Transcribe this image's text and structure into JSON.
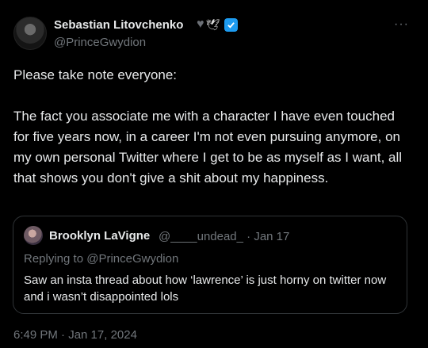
{
  "author": {
    "display_name": "Sebastian Litovchenko",
    "handle": "@PrinceGwydion",
    "badges": [
      "black-heart",
      "wing"
    ]
  },
  "tweet": {
    "paragraph1": "Please take note everyone:",
    "paragraph2": "The fact you associate me with a character I have even touched for five years now, in a career I'm not even pursuing anymore, on my own personal Twitter where I get to be as myself as I want, all that shows you don't give a shit about my happiness.",
    "timestamp": "6:49 PM · Jan 17, 2024"
  },
  "quote": {
    "display_name": "Brooklyn LaVigne",
    "handle": "@____undead_",
    "date": "Jan 17",
    "meta": "@____undead_ · Jan 17",
    "replying_to": "Replying to @PrinceGwydion",
    "text": "Saw an insta thread about how ‘lawrence’ is just horny on twitter now and i wasn’t disappointed lols"
  },
  "icons": {
    "more": "more-horizontal-icon",
    "verified": "verified-badge-icon"
  },
  "colors": {
    "background": "#000000",
    "text": "#e7e9ea",
    "muted": "#71767b",
    "verified": "#1d9bf0",
    "border": "#2f3336"
  }
}
